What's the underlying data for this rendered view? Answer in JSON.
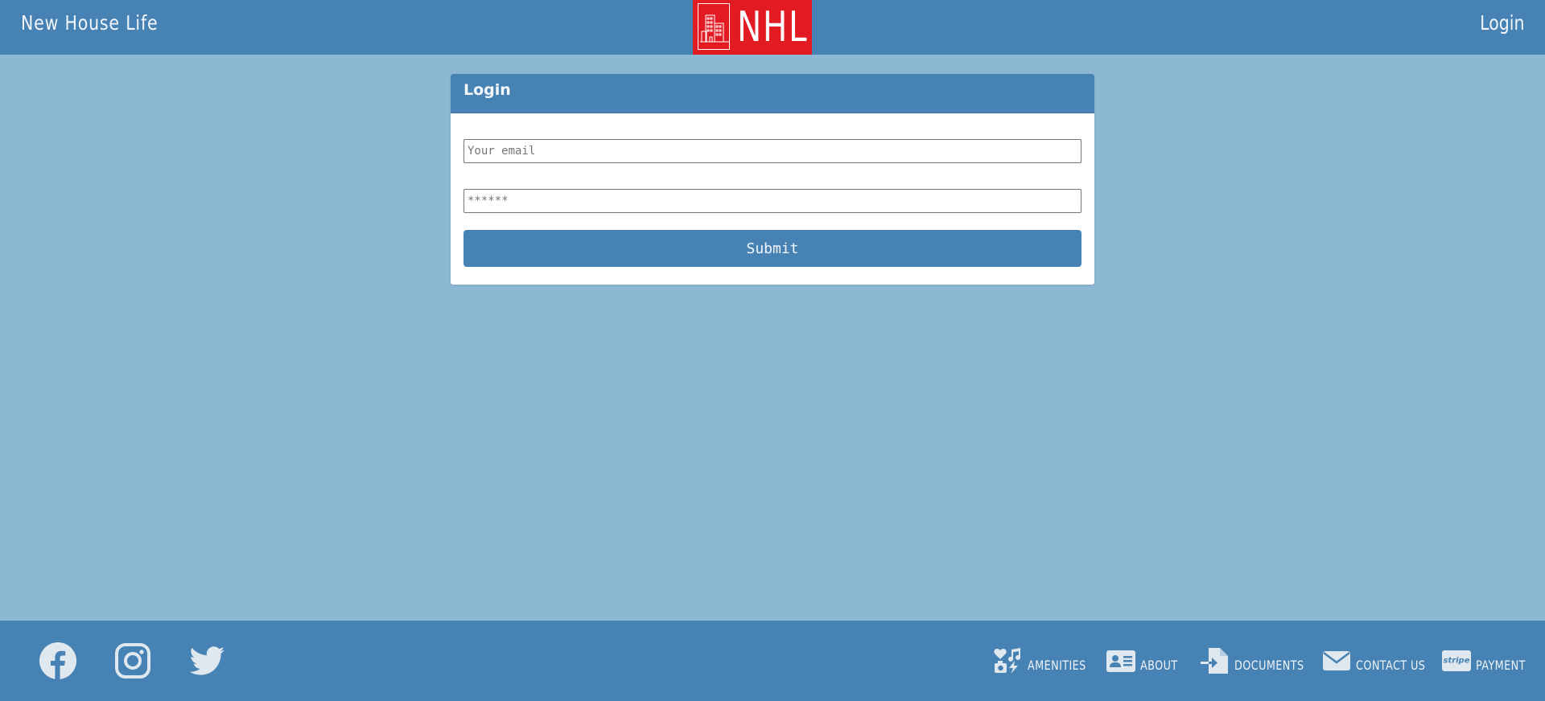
{
  "header": {
    "brand": "New House Life",
    "logo_text": "NHL",
    "login_label": "Login"
  },
  "login_card": {
    "title": "Login",
    "email_placeholder": "Your email",
    "password_placeholder": "******",
    "submit_label": "Submit"
  },
  "footer": {
    "social": [
      {
        "icon": "facebook-icon"
      },
      {
        "icon": "instagram-icon"
      },
      {
        "icon": "twitter-icon"
      }
    ],
    "nav": [
      {
        "icon": "amenities-icon",
        "label": "AMENITIES"
      },
      {
        "icon": "id-card-icon",
        "label": "ABOUT"
      },
      {
        "icon": "document-import-icon",
        "label": "DOCUMENTS"
      },
      {
        "icon": "envelope-icon",
        "label": "CONTACT US"
      },
      {
        "icon": "stripe-icon",
        "label": "PAYMENT"
      }
    ]
  },
  "colors": {
    "primary": "#4682b4",
    "background": "#8cb8d4",
    "logo_red": "#e21b23",
    "card": "#ffffff"
  }
}
